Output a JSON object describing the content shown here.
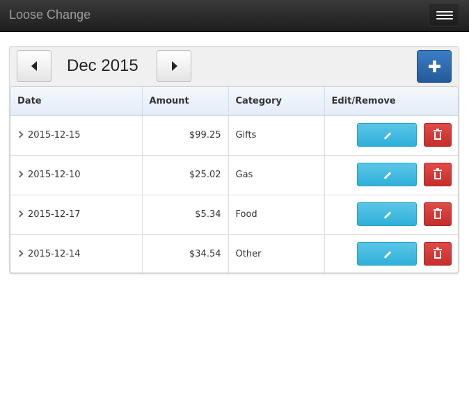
{
  "app": {
    "title": "Loose Change"
  },
  "toolbar": {
    "month_label": "Dec 2015"
  },
  "table": {
    "headers": [
      "Date",
      "Amount",
      "Category",
      "Edit/Remove"
    ],
    "rows": [
      {
        "date": "2015-12-15",
        "amount": "$99.25",
        "category": "Gifts"
      },
      {
        "date": "2015-12-10",
        "amount": "$25.02",
        "category": "Gas"
      },
      {
        "date": "2015-12-17",
        "amount": "$5.34",
        "category": "Food"
      },
      {
        "date": "2015-12-14",
        "amount": "$34.54",
        "category": "Other"
      }
    ]
  },
  "icons": {
    "menu": "hamburger-icon",
    "prev": "caret-left-icon",
    "next": "caret-right-icon",
    "add": "plus-icon",
    "expand": "chevron-right-icon",
    "edit": "pencil-icon",
    "delete": "trash-icon"
  },
  "colors": {
    "navbar": "#222222",
    "primary": "#2a6aad",
    "info": "#39b3d7",
    "danger": "#d2322d"
  }
}
